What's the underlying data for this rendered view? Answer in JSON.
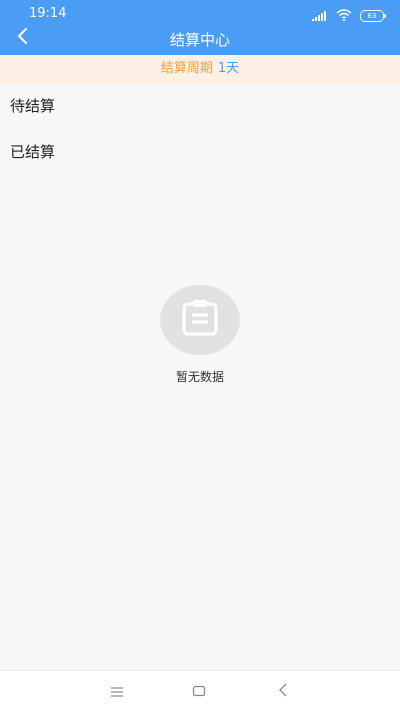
{
  "status": {
    "time": "19:14",
    "battery": "63"
  },
  "header": {
    "title": "结算中心"
  },
  "period": {
    "label": "结算周期",
    "value": "1天"
  },
  "list": {
    "items": [
      {
        "label": "待结算"
      },
      {
        "label": "已结算"
      }
    ]
  },
  "empty": {
    "text": "暂无数据"
  },
  "colors": {
    "primary": "#4a9cf5",
    "banner_bg": "#fbf0e3",
    "banner_text": "#f0a04a",
    "page_bg": "#f7f7f7"
  }
}
